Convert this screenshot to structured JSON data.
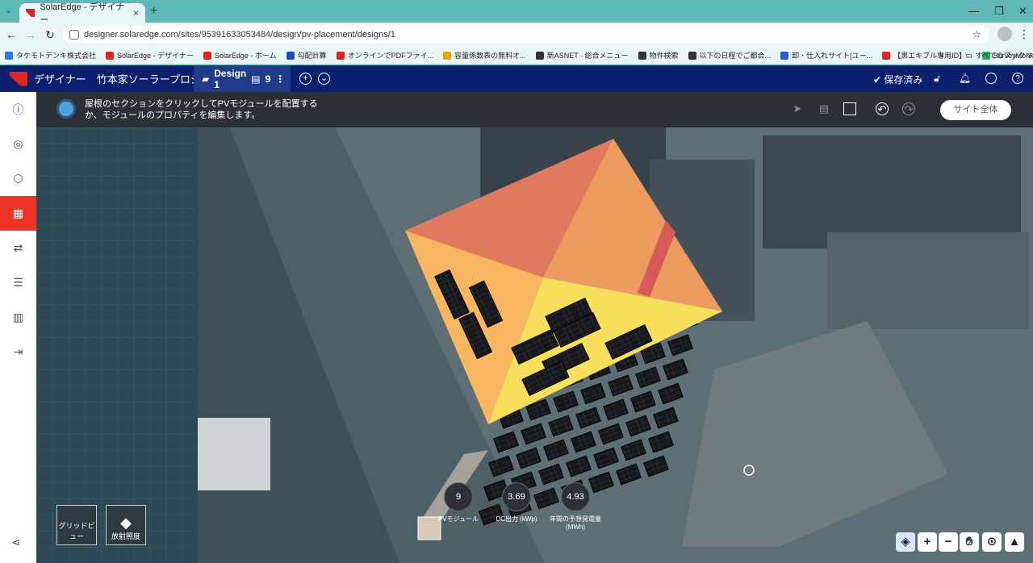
{
  "browser": {
    "tab_title": "SolarEdge - デザイナー",
    "url": "designer.solaredge.com/sites/95391633053484/design/pv-placement/designs/1",
    "bookmarks": [
      {
        "label": "タケモトデンキ株式会社",
        "color": "#2a7ae2"
      },
      {
        "label": "SolarEdge - デザイナー",
        "color": "#e02424"
      },
      {
        "label": "SolarEdge - ホーム",
        "color": "#e02424"
      },
      {
        "label": "勾配計算",
        "color": "#1a4bbd"
      },
      {
        "label": "オンラインでPDFファイ...",
        "color": "#e02424"
      },
      {
        "label": "容量係数表の無料オ...",
        "color": "#e8a800"
      },
      {
        "label": "新ASNET - 総合メニュー",
        "color": "#333"
      },
      {
        "label": "物件検索",
        "color": "#333"
      },
      {
        "label": "以下の日程でご都合...",
        "color": "#333"
      },
      {
        "label": "卸・仕入れサイト[ユー...",
        "color": "#2a5bd7"
      },
      {
        "label": "【黒エキブル専用ID】...",
        "color": "#e02424"
      },
      {
        "label": "SurveyMonkeyによう...",
        "color": "#1fb563"
      }
    ],
    "bookmarks_more": "»",
    "all_bookmarks": "すべてのブックマーク"
  },
  "app": {
    "title": "デザイナー　竹本家ソーラープロジェクト",
    "design_tab": "Design 1",
    "design_count": "9",
    "saved_label": "保存済み",
    "accent": "#0a1f6e",
    "brand_red": "#ee3224"
  },
  "hint": {
    "text": "屋根のセクションをクリックしてPVモジュールを配置するか、モジュールのプロパティを編集します。",
    "site_button": "サイト全体"
  },
  "bottom": {
    "grid_view": "グリッドビュー",
    "irradiance": "放射照度",
    "stats": [
      {
        "value": "9",
        "label": "PVモジュール"
      },
      {
        "value": "3.69",
        "label": "DC出力 (kWp)"
      },
      {
        "value": "4.93",
        "label": "年間の予想発電量 (MWh)"
      }
    ]
  }
}
